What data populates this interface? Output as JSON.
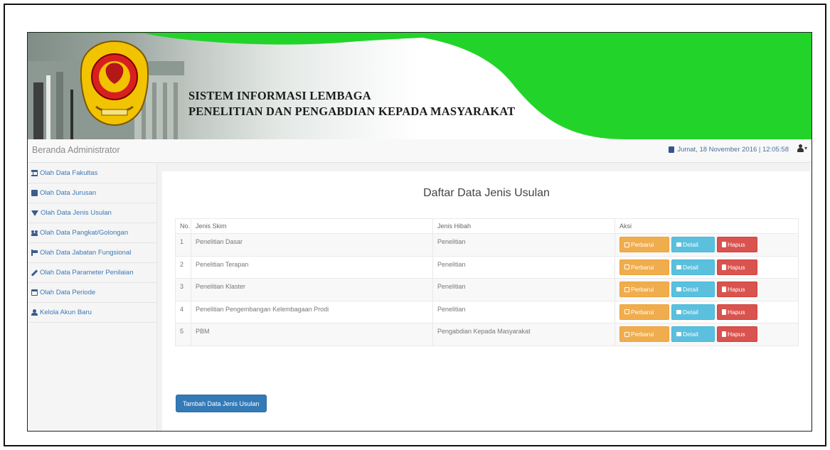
{
  "header": {
    "title_line1": "SISTEM INFORMASI LEMBAGA",
    "title_line2": "PENELITIAN DAN PENGABDIAN KEPADA MASYARAKAT"
  },
  "navbar": {
    "brand": "Beranda Administrator",
    "datetime": "Jumat, 18 November 2016 | 12:05:58"
  },
  "sidebar": {
    "items": [
      {
        "label": "Olah Data Fakultas",
        "icon": "bank-icon"
      },
      {
        "label": "Olah Data Jurusan",
        "icon": "book-icon"
      },
      {
        "label": "Olah Data Jenis Usulan",
        "icon": "filter-icon"
      },
      {
        "label": "Olah Data Pangkat/Golongan",
        "icon": "users-icon"
      },
      {
        "label": "Olah Data Jabatan Fungsional",
        "icon": "flag-icon"
      },
      {
        "label": "Olah Data Parameter Penilaian",
        "icon": "pencil-icon"
      },
      {
        "label": "Olah Data Periode",
        "icon": "calendar-icon"
      },
      {
        "label": "Kelola Akun Baru",
        "icon": "user-icon"
      }
    ]
  },
  "main": {
    "title": "Daftar Data Jenis Usulan",
    "columns": [
      "No.",
      "Jenis Skim",
      "Jenis Hibah",
      "Aksi"
    ],
    "rows": [
      {
        "no": "1",
        "skim": "Penelitian Dasar",
        "hibah": "Penelitian"
      },
      {
        "no": "2",
        "skim": "Penelitian Terapan",
        "hibah": "Penelitian"
      },
      {
        "no": "3",
        "skim": "Penelitian Klaster",
        "hibah": "Penelitian"
      },
      {
        "no": "4",
        "skim": "Penelitian Pengembangan Kelembagaan Prodi",
        "hibah": "Penelitian"
      },
      {
        "no": "5",
        "skim": "PBM",
        "hibah": "Pengabdian Kepada Masyarakat"
      }
    ],
    "actions": {
      "edit": "Perbarui",
      "detail": "Detail",
      "delete": "Hapus"
    },
    "add_button": "Tambah Data Jenis Usulan"
  },
  "colors": {
    "banner_green": "#22d429",
    "edit": "#f0ad4e",
    "detail": "#5bc0de",
    "delete": "#d9534f",
    "primary": "#337ab7"
  }
}
